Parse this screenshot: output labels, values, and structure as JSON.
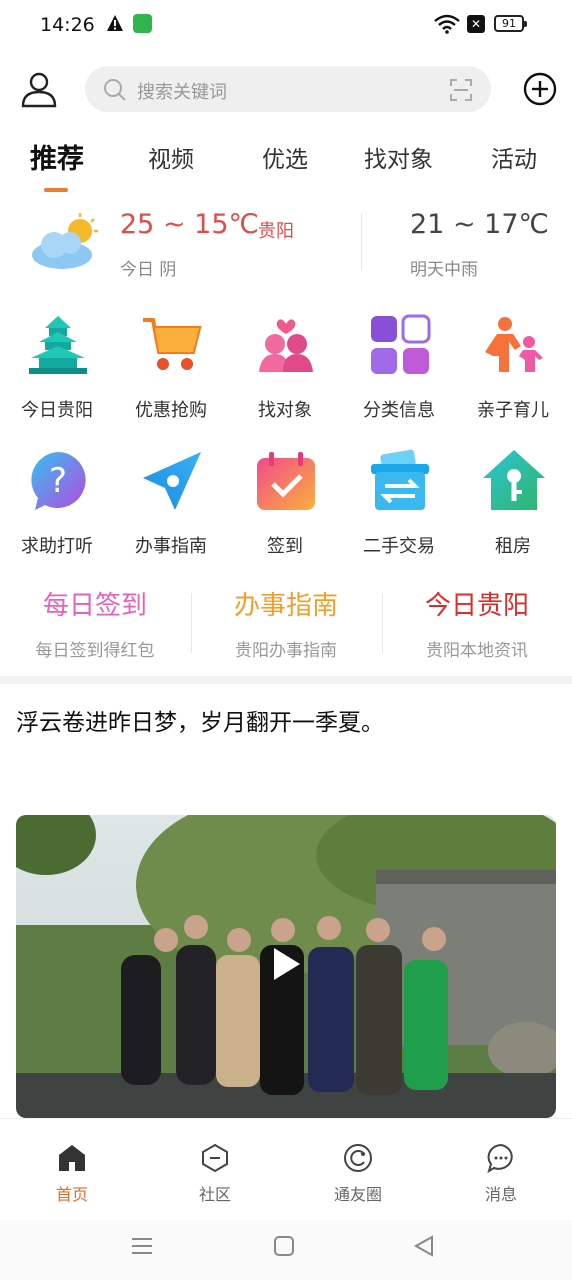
{
  "status_bar": {
    "time": "14:26",
    "battery": "91"
  },
  "search": {
    "placeholder": "搜索关键词"
  },
  "tabs": [
    {
      "label": "推荐",
      "active": true
    },
    {
      "label": "视频"
    },
    {
      "label": "优选"
    },
    {
      "label": "找对象"
    },
    {
      "label": "活动"
    }
  ],
  "weather": {
    "today_temp": "25 ~ 15℃",
    "city": "贵阳",
    "today_desc": "今日 阴",
    "tomorrow_temp": "21 ~ 17℃",
    "tomorrow_desc": "明天中雨"
  },
  "grid": [
    {
      "label": "今日贵阳",
      "icon": "pavilion-icon"
    },
    {
      "label": "优惠抢购",
      "icon": "shopping-cart-icon"
    },
    {
      "label": "找对象",
      "icon": "couple-icon"
    },
    {
      "label": "分类信息",
      "icon": "category-grid-icon"
    },
    {
      "label": "亲子育儿",
      "icon": "parent-child-icon"
    },
    {
      "label": "求助打听",
      "icon": "question-icon"
    },
    {
      "label": "办事指南",
      "icon": "compass-icon"
    },
    {
      "label": "签到",
      "icon": "calendar-check-icon"
    },
    {
      "label": "二手交易",
      "icon": "exchange-box-icon"
    },
    {
      "label": "租房",
      "icon": "house-key-icon"
    }
  ],
  "quick_links": [
    {
      "title": "每日签到",
      "subtitle": "每日签到得红包",
      "color": "#e75fbf"
    },
    {
      "title": "办事指南",
      "subtitle": "贵阳办事指南",
      "color": "#f0a02a"
    },
    {
      "title": "今日贵阳",
      "subtitle": "贵阳本地资讯",
      "color": "#e02a2a"
    }
  ],
  "post": {
    "text": "浮云卷进昨日梦，岁月翻开一季夏。"
  },
  "nav": [
    {
      "label": "首页",
      "active": true
    },
    {
      "label": "社区"
    },
    {
      "label": "通友圈"
    },
    {
      "label": "消息"
    }
  ],
  "colors": {
    "accent": "#e8692a",
    "weather_red": "#e24b48"
  }
}
